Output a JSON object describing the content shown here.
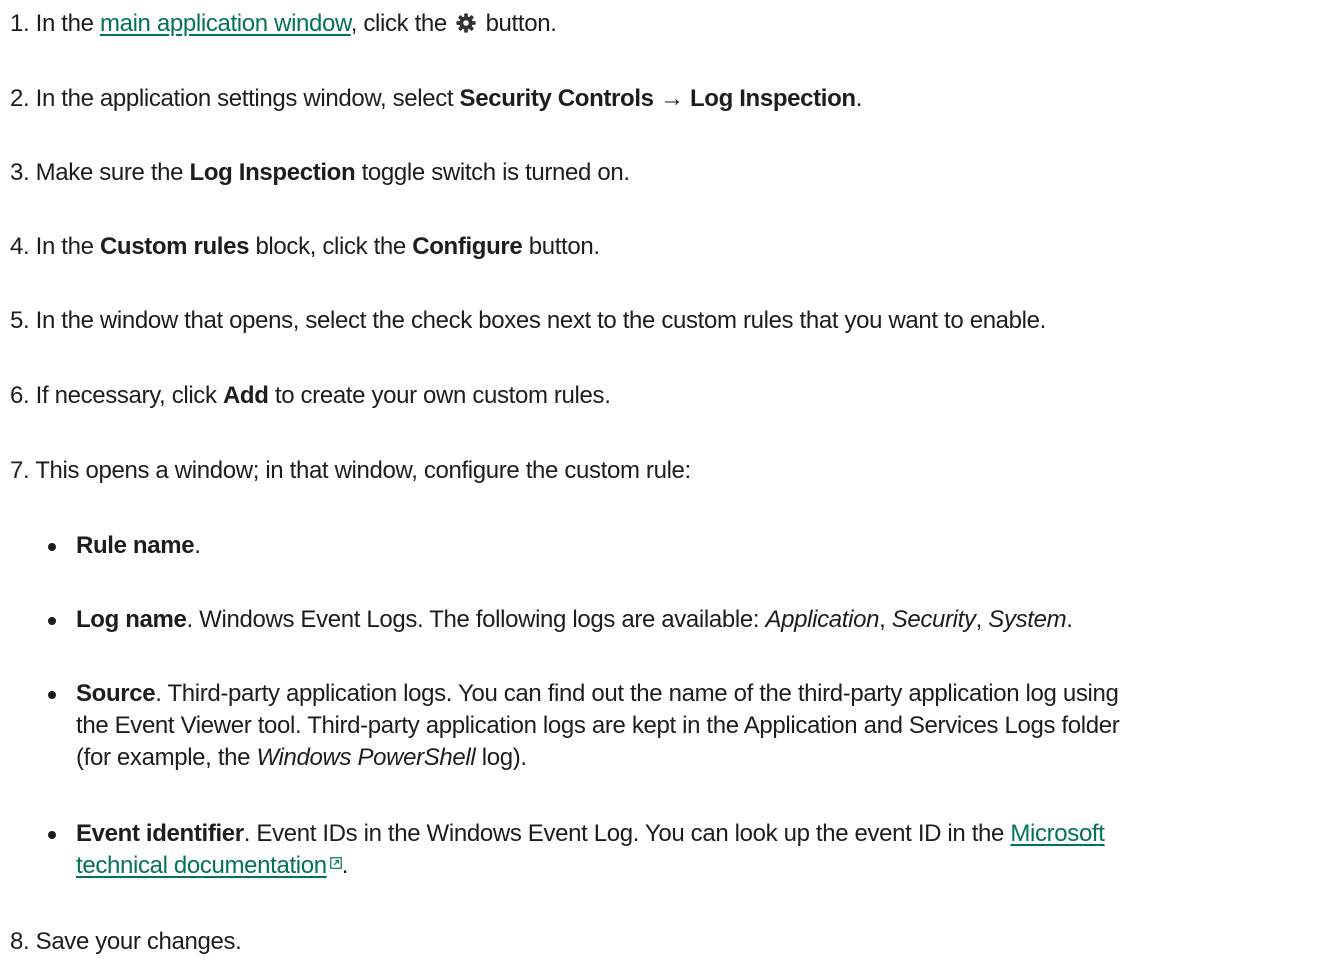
{
  "steps": [
    {
      "number": "1.",
      "t1": "In the",
      "link": "main application window",
      "t2": ", click the",
      "icon": "gear-icon",
      "t3": "button."
    },
    {
      "number": "2.",
      "t1": "In the application settings window, select",
      "b1": "Security Controls",
      "arrow": "→",
      "b2": "Log Inspection",
      "t2": "."
    },
    {
      "number": "3.",
      "t1": "Make sure the",
      "b1": "Log Inspection",
      "t2": "toggle switch is turned on."
    },
    {
      "number": "4.",
      "t1": "In the",
      "b1": "Custom rules",
      "t2": "block, click the",
      "b2": "Configure",
      "t3": "button."
    },
    {
      "number": "5.",
      "t1": "In the window that opens, select the check boxes next to the custom rules that you want to enable."
    },
    {
      "number": "6.",
      "t1": "If necessary, click",
      "b1": "Add",
      "t2": "to create your own custom rules."
    },
    {
      "number": "7.",
      "t1": "This opens a window; in that window, configure the custom rule:"
    },
    {
      "number": "8.",
      "t1": "Save your changes."
    }
  ],
  "bullets": [
    {
      "b1": "Rule name",
      "t1": "."
    },
    {
      "b1": "Log name",
      "t1": ". Windows Event Logs. The following logs are available:",
      "i1": "Application",
      "t2": ",",
      "i2": "Security",
      "t3": ",",
      "i3": "System",
      "t4": "."
    },
    {
      "b1": "Source",
      "t1": ". Third-party application logs. You can find out the name of the third-party application log using",
      "t2": "the Event Viewer tool. Third-party application logs are kept in the Application and Services Logs folder",
      "t3": "(for example, the",
      "i1": "Windows PowerShell",
      "t4": "log)."
    },
    {
      "b1": "Event identifier",
      "t1": ". Event IDs in the Windows Event Log. You can look up the event ID in the",
      "link1": "Microsoft",
      "link2": "technical documentation",
      "ext_icon": "external-link-icon",
      "t2": "."
    }
  ],
  "colors": {
    "text": "#1d1d1b",
    "link": "#00735a",
    "background": "#ffffff"
  }
}
